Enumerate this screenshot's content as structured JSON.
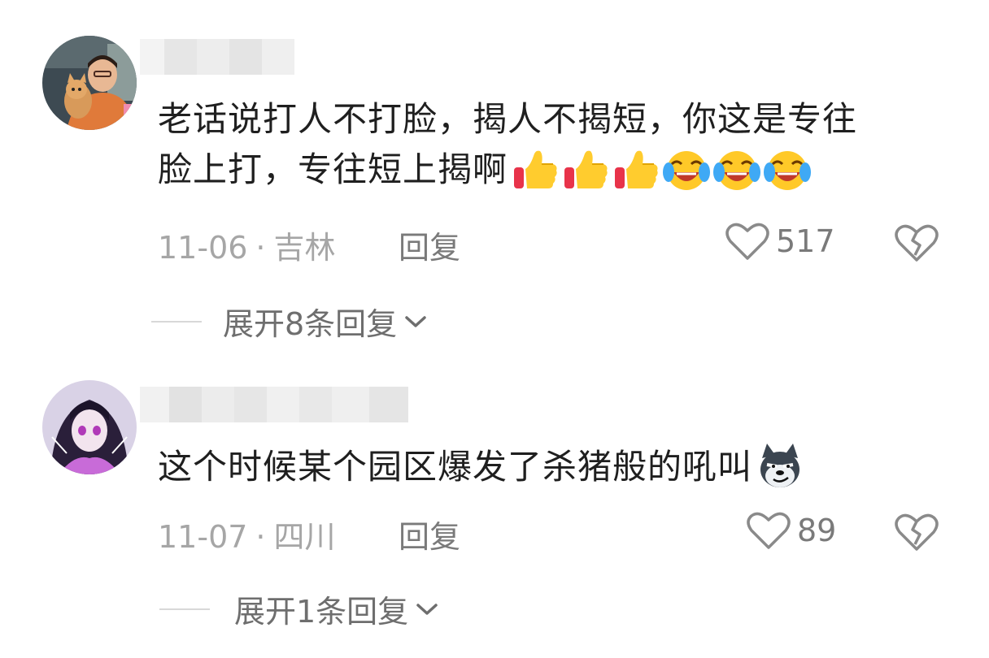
{
  "comments": [
    {
      "avatar_icon": "user-avatar-woman-with-cat",
      "text_line1": "老话说打人不打脸，揭人不揭短，你这是专往",
      "text_line2": "脸上打，专往短上揭啊",
      "emojis": [
        "thumbs-up-emoji",
        "thumbs-up-emoji",
        "thumbs-up-emoji",
        "tears-of-joy-emoji",
        "tears-of-joy-emoji",
        "tears-of-joy-emoji"
      ],
      "date": "11-06",
      "location": "吉林",
      "reply_label": "回复",
      "likes": "517",
      "expand_label": "展开8条回复"
    },
    {
      "avatar_icon": "user-avatar-anime-girl",
      "text_line1": "这个时候某个园区爆发了杀猪般的吼叫",
      "emojis": [
        "smug-dog-emoji"
      ],
      "date": "11-07",
      "location": "四川",
      "reply_label": "回复",
      "likes": "89",
      "expand_label": "展开1条回复"
    }
  ],
  "meta_separator": "·",
  "colors": {
    "text": "#1f1f1f",
    "meta": "#a6a6a6",
    "action": "#7a7a7a"
  }
}
